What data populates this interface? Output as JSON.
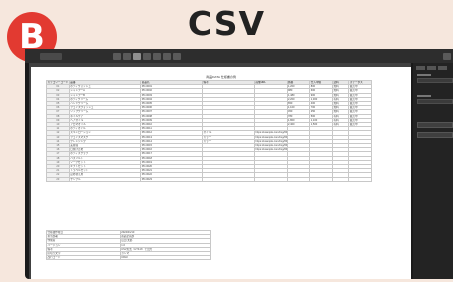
{
  "badge": "B",
  "title": "CSV",
  "document": {
    "title": "商品DATA 仕様書の例",
    "columns": [
      "カテゴリーコード",
      "品番",
      "商品名",
      "備考",
      "画像URL",
      "価格",
      "仕入単価",
      "送料",
      "ステータス"
    ],
    "rows": [
      [
        "01",
        "ボディウォッシュ",
        "PD-0001",
        "",
        "",
        "1,200",
        "800",
        "無料",
        "販売中"
      ],
      [
        "02",
        "シャンプーA",
        "PD-0002",
        "",
        "",
        "980",
        "600",
        "無料",
        "販売中"
      ],
      [
        "03",
        "シャンプーB",
        "PD-0003",
        "",
        "",
        "1,480",
        "900",
        "無料",
        "販売中"
      ],
      [
        "04",
        "ボディクリーム",
        "PD-0004",
        "",
        "",
        "2,200",
        "1,300",
        "有料",
        "販売中"
      ],
      [
        "05",
        "ハンドクリーム",
        "PD-0005",
        "",
        "",
        "650",
        "400",
        "無料",
        "販売中"
      ],
      [
        "06",
        "フェイスウォッシュ",
        "PD-0006",
        "",
        "",
        "1,100",
        "700",
        "無料",
        "販売中"
      ],
      [
        "07",
        "リップクリーム",
        "PD-0007",
        "",
        "",
        "450",
        "250",
        "無料",
        "販売中"
      ],
      [
        "08",
        "ネイルケア",
        "PD-0008",
        "",
        "",
        "780",
        "500",
        "有料",
        "販売中"
      ],
      [
        "09",
        "ヘアオイル",
        "PD-0009",
        "",
        "",
        "1,800",
        "1,100",
        "有料",
        "販売中"
      ],
      [
        "10",
        "アロマオイル",
        "PD-0010",
        "",
        "",
        "2,400",
        "1,500",
        "有料",
        "販売中"
      ],
      [
        "11",
        "ボディオイル",
        "PD-0011",
        "",
        "",
        "",
        "",
        "",
        ""
      ],
      [
        "12",
        "スキンローション",
        "PD-0012",
        "オイル",
        "https://example.com/img/0012.jpg",
        "",
        "",
        "",
        ""
      ],
      [
        "13",
        "フェイスマスク",
        "PD-0013",
        "カラー",
        "https://example.com/img/0013.jpg",
        "",
        "",
        "",
        ""
      ],
      [
        "14",
        "クレンジング",
        "PD-0014",
        "カラー",
        "https://example.com/img/0014.jpg",
        "",
        "",
        "",
        ""
      ],
      [
        "15",
        "美容液",
        "PD-0015",
        "",
        "https://example.com/img/0015.jpg",
        "",
        "",
        "",
        ""
      ],
      [
        "16",
        "日焼け止め",
        "PD-0016",
        "",
        "https://example.com/img/0016.jpg",
        "",
        "",
        "",
        ""
      ],
      [
        "17",
        "ボディスクラブ",
        "PD-0017",
        "",
        "",
        "",
        "",
        "",
        ""
      ],
      [
        "18",
        "バスソルト",
        "PD-0018",
        "",
        "",
        "",
        "",
        "",
        ""
      ],
      [
        "19",
        "ソープセット",
        "PD-0019",
        "",
        "",
        "",
        "",
        "",
        ""
      ],
      [
        "20",
        "ギフトセット",
        "PD-0020",
        "",
        "",
        "",
        "",
        "",
        ""
      ],
      [
        "21",
        "トラベルセット",
        "PD-0021",
        "",
        "",
        "",
        "",
        "",
        ""
      ],
      [
        "22",
        "詰め替え用",
        "PD-0022",
        "",
        "",
        "",
        "",
        "",
        ""
      ],
      [
        "23",
        "サンプル",
        "PD-0023",
        "",
        "",
        "",
        "",
        "",
        ""
      ]
    ],
    "meta": [
      [
        "仕様書作成日",
        "2024/01/10"
      ],
      [
        "担当部署",
        "商品企画部"
      ],
      [
        "作成者",
        "山田 太郎"
      ],
      [
        "バージョン",
        "1.0"
      ],
      [
        "備考",
        "CSV形式（UTF-8）で出力"
      ],
      [
        "区切り文字",
        "カンマ"
      ],
      [
        "改行コード",
        "CRLF"
      ]
    ]
  },
  "toolbar": {
    "tools": [
      "select",
      "crop",
      "text",
      "shape",
      "zoom",
      "hand",
      "comment"
    ]
  },
  "panel": {
    "labels": [
      "Width",
      "Height"
    ],
    "buttons": [
      "Export",
      "Cancel"
    ]
  }
}
